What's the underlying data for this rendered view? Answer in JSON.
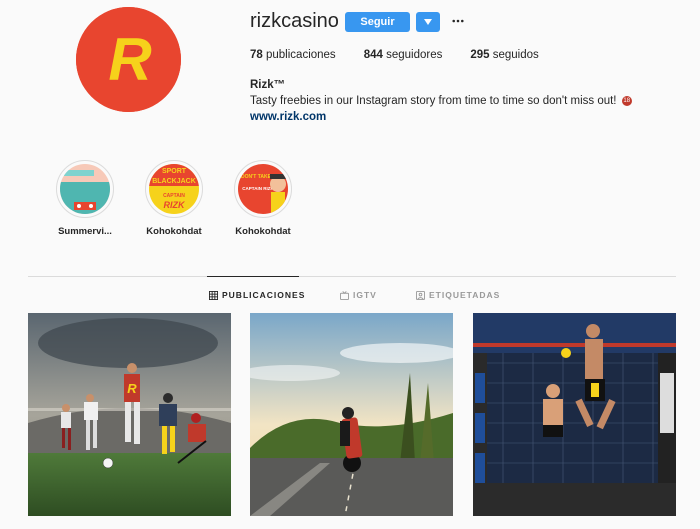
{
  "profile": {
    "username": "rizkcasino",
    "follow_label": "Seguir",
    "stats": {
      "posts_count": "78",
      "posts_label": "publicaciones",
      "followers_count": "844",
      "followers_label": "seguidores",
      "following_count": "295",
      "following_label": "seguidos"
    },
    "bio_name": "Rizk™",
    "bio_text": "Tasty freebies in our Instagram story from time to time so don't miss out!",
    "bio_link": "www.rizk.com"
  },
  "highlights": [
    {
      "label": "Summervi...",
      "icon": "summer-highlight"
    },
    {
      "label": "Kohokohdat",
      "icon": "blackjack-highlight",
      "overlay_text": [
        "SPORT",
        "BLACKJACK",
        "CAPTAIN",
        "RIZK"
      ]
    },
    {
      "label": "Kohokohdat",
      "icon": "captain-rizk-highlight",
      "overlay_text": [
        "DON'T TAKE",
        "CAPTAIN RIZK"
      ]
    }
  ],
  "tabs": [
    {
      "label": "PUBLICACIONES",
      "icon": "grid-icon",
      "active": true
    },
    {
      "label": "IGTV",
      "icon": "tv-icon",
      "active": false
    },
    {
      "label": "ETIQUETADAS",
      "icon": "tag-icon",
      "active": false
    }
  ],
  "posts": [
    {
      "name": "sports-stadium-post"
    },
    {
      "name": "motorcycle-road-post"
    },
    {
      "name": "mma-cage-fight-post"
    }
  ],
  "colors": {
    "brand_red": "#e8452f",
    "brand_yellow": "#f6d21b",
    "button_blue": "#3897f0",
    "link": "#003569"
  }
}
